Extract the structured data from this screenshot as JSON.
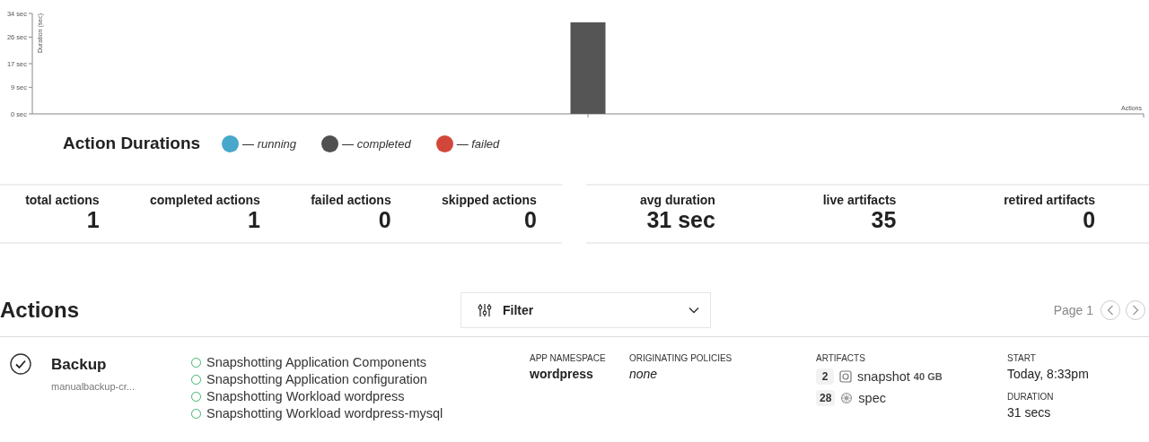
{
  "chart": {
    "chart_data": {
      "type": "bar",
      "xlabel": "Actions",
      "ylabel": "Duration (sec)",
      "ylim": [
        0,
        34
      ],
      "yticks": [
        {
          "value": 0,
          "label": "0 sec"
        },
        {
          "value": 9,
          "label": "9 sec"
        },
        {
          "value": 17,
          "label": "17 sec"
        },
        {
          "value": 26,
          "label": "26 sec"
        },
        {
          "value": 34,
          "label": "34 sec"
        }
      ],
      "series": [
        {
          "color": "#555555",
          "values": [
            31
          ]
        }
      ]
    }
  },
  "legend": {
    "title": "Action Durations",
    "items": [
      {
        "label": "— running",
        "color": "#48a8cb"
      },
      {
        "label": "— completed",
        "color": "#505050"
      },
      {
        "label": "— failed",
        "color": "#d2473a"
      }
    ]
  },
  "stat_groups": [
    {
      "stats": [
        {
          "label": "total actions",
          "value": "1"
        },
        {
          "label": "completed actions",
          "value": "1"
        },
        {
          "label": "failed actions",
          "value": "0"
        },
        {
          "label": "skipped actions",
          "value": "0"
        }
      ]
    },
    {
      "stats": [
        {
          "label": "avg duration",
          "value": "31 sec"
        },
        {
          "label": "live artifacts",
          "value": "35"
        },
        {
          "label": "retired artifacts",
          "value": "0"
        }
      ]
    }
  ],
  "actions_header": {
    "title": "Actions",
    "filter": {
      "label": "Filter"
    },
    "pagination": {
      "label": "Page 1"
    }
  },
  "actions": [
    {
      "completed": true,
      "title": "Backup",
      "subtitle": "manualbackup-cr...",
      "steps": [
        {
          "label": "Snapshotting Application Components",
          "done": true
        },
        {
          "label": "Snapshotting Application configuration",
          "done": true
        },
        {
          "label": "Snapshotting Workload wordpress",
          "done": true
        },
        {
          "label": "Snapshotting Workload wordpress-mysql",
          "done": true
        }
      ],
      "app_namespace": {
        "label": "APP NAMESPACE",
        "value": "wordpress"
      },
      "originating_policies": {
        "label": "ORIGINATING POLICIES",
        "value": "none"
      },
      "artifacts": {
        "label": "ARTIFACTS",
        "items": [
          {
            "count": "2",
            "kind": "snapshot",
            "name": "snapshot",
            "size": "40 GB"
          },
          {
            "count": "28",
            "kind": "spec",
            "name": "spec"
          }
        ]
      },
      "start": {
        "label": "START",
        "value": "Today, 8:33pm"
      },
      "duration": {
        "label": "DURATION",
        "value": "31 secs"
      }
    }
  ]
}
